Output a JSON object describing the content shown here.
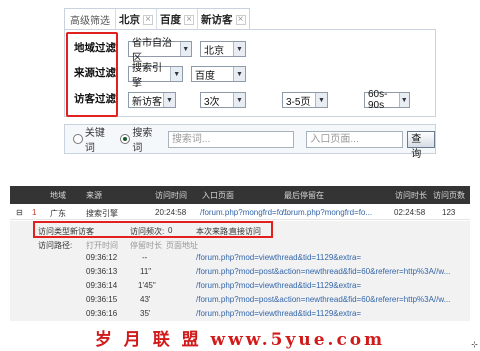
{
  "filter": {
    "title": "高级筛选",
    "chips": [
      "北京",
      "百度",
      "新访客"
    ],
    "close_glyph": "×"
  },
  "rows": {
    "region": {
      "label": "地域过滤",
      "sel1": "省市自治区",
      "sel2": "北京"
    },
    "source": {
      "label": "来源过滤",
      "sel1": "搜索引擎",
      "sel2": "百度"
    },
    "visitor": {
      "label": "访客过滤",
      "sel1": "新访客",
      "sel2": "3次",
      "sel3": "3-5页",
      "sel4": "60s-90s"
    }
  },
  "search": {
    "opt_keyword": "关键词",
    "opt_search": "搜索词",
    "search_placeholder": "搜索词...",
    "entry_placeholder": "入口页面...",
    "query_label": "查询"
  },
  "table": {
    "headers": [
      "地域",
      "来源",
      "访问时间",
      "入口页面",
      "最后停留在",
      "访问时长",
      "访问页数"
    ],
    "row": {
      "toggle": "⊟",
      "index": "1",
      "region": "广东",
      "source": "搜索引擎",
      "time": "20:24:58",
      "entry": "/forum.php?mongfrd=fo...",
      "last": "/forum.php?mongfrd=fo...",
      "duration": "02:24:58",
      "pages": "123"
    },
    "detail": {
      "type_label": "访问类型:",
      "type_value": "新访客",
      "count_label": "访问频次:",
      "count_value": "0",
      "source_label": "本次来路:",
      "source_value": "直接访问",
      "path_label": "访问路径:",
      "sub_headers": [
        "打开时间",
        "停留时长",
        "页面地址"
      ],
      "paths": [
        {
          "time": "09:36:12",
          "stay": "--",
          "url": "/forum.php?mod=viewthread&tid=1129&extra="
        },
        {
          "time": "09:36:13",
          "stay": "11\"",
          "url": "/forum.php?mod=post&action=newthread&fid=60&referer=http%3A//w..."
        },
        {
          "time": "09:36:14",
          "stay": "1'45\"",
          "url": "/forum.php?mod=viewthread&tid=1129&extra="
        },
        {
          "time": "09:36:15",
          "stay": "43'",
          "url": "/forum.php?mod=post&action=newthread&fid=60&referer=http%3A//w..."
        },
        {
          "time": "09:36:16",
          "stay": "35'",
          "url": "/forum.php?mod=viewthread&tid=1129&extra="
        }
      ]
    }
  },
  "footer": "岁 月 联 盟   www.5yue.com",
  "corner": "⊹"
}
